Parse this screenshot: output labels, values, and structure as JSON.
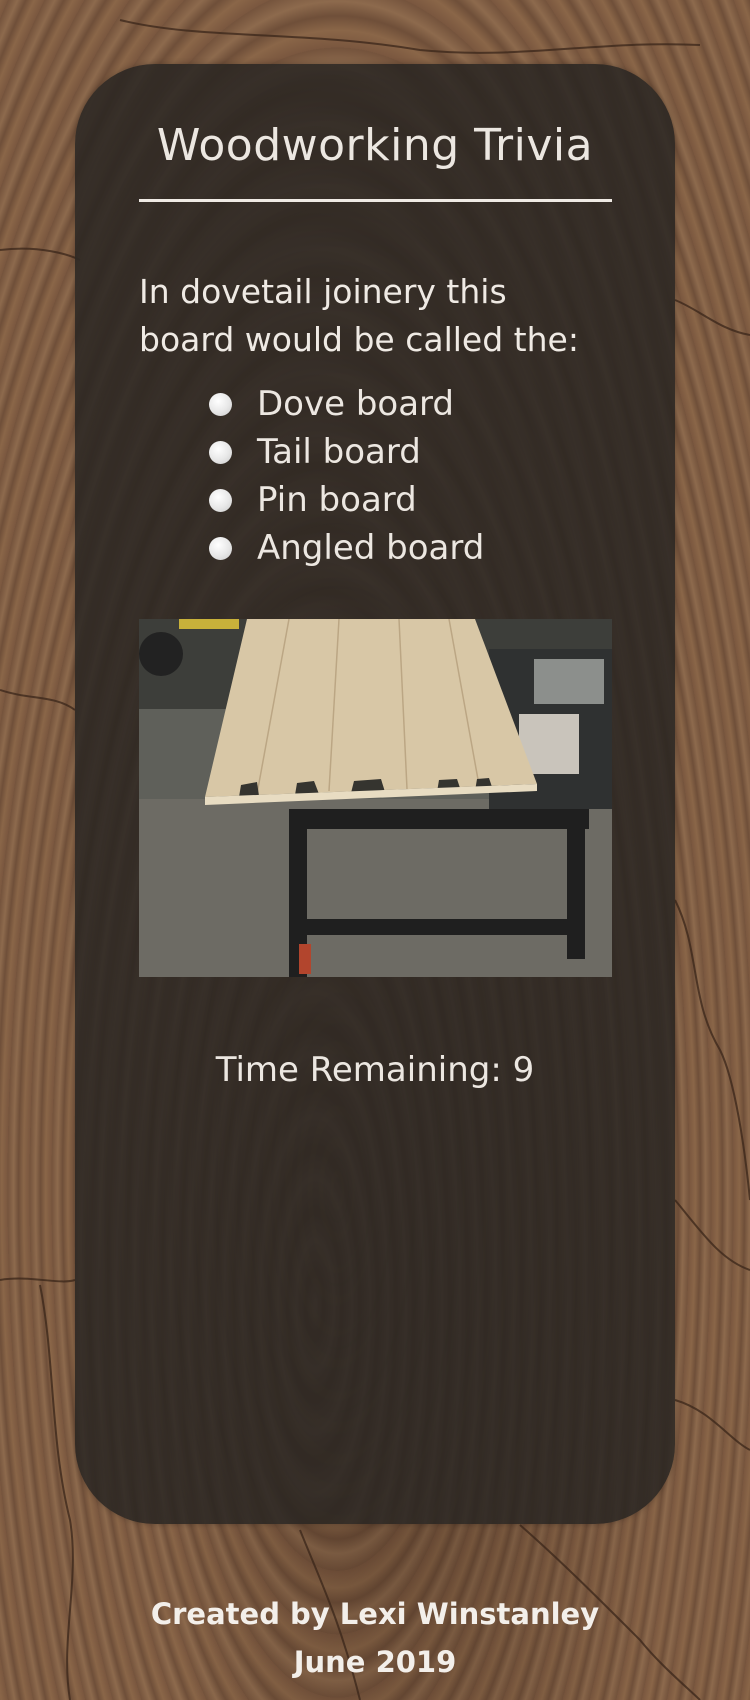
{
  "app": {
    "title": "Woodworking Trivia"
  },
  "question": {
    "text": "In dovetail joinery this board would be called the:",
    "answers": [
      {
        "label": "Dove board"
      },
      {
        "label": "Tail board"
      },
      {
        "label": "Pin board"
      },
      {
        "label": "Angled board"
      }
    ]
  },
  "timer": {
    "text": "Time Remaining: 9"
  },
  "footer": {
    "credit": "Created by Lexi Winstanley",
    "date": "June 2019"
  },
  "colors": {
    "card": "#302924",
    "text": "#ece7e1",
    "wood": "#7b5a40"
  }
}
